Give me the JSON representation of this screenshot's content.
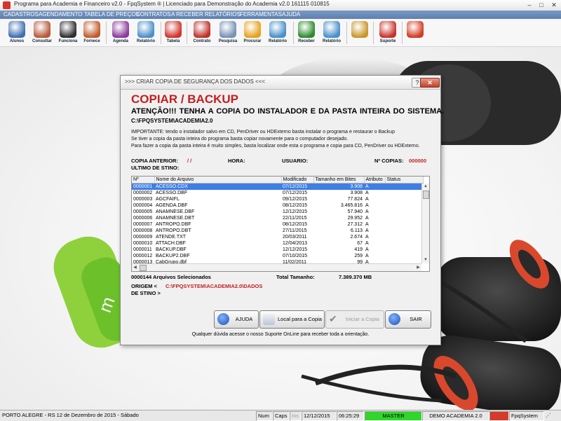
{
  "window": {
    "title": "Programa para Academia e Financeiro v2.0 - FpqSystem ® | Licenciado para  Demonstração do Academia v2.0 161115 010815",
    "minimize": "–",
    "maximize": "□",
    "close": "✕"
  },
  "menu": [
    "CADASTROS",
    "AGENDAMENTO",
    "TABELA DE PREÇOS",
    "CONTRATOS",
    "A RECEBER",
    "RELATÓRIOS",
    "FERRAMENTAS",
    "AJUDA"
  ],
  "toolbar": [
    {
      "label": "Alunos",
      "icon": "students-icon",
      "color": "#3f6fb3"
    },
    {
      "label": "Consultar",
      "icon": "id-card-icon",
      "color": "#b85a3a"
    },
    {
      "label": "Funciona",
      "icon": "employees-icon",
      "color": "#2f2f2f"
    },
    {
      "label": "Fornece",
      "icon": "supplier-icon",
      "color": "#c25c2c"
    },
    {
      "label": "Agenda",
      "icon": "calendar-icon",
      "color": "#8c3b9d"
    },
    {
      "label": "Relatório",
      "icon": "report-icon",
      "color": "#4a90c9"
    },
    {
      "label": "Tabela",
      "icon": "price-table-icon",
      "color": "#d0342c"
    },
    {
      "label": "Contrato",
      "icon": "contract-pen-icon",
      "color": "#c0312b"
    },
    {
      "label": "Pesquisa",
      "icon": "search-document-icon",
      "color": "#7891b5"
    },
    {
      "label": "Procurar",
      "icon": "folder-icon",
      "color": "#e6a21f"
    },
    {
      "label": "Relatório",
      "icon": "report-icon",
      "color": "#4a90c9"
    },
    {
      "label": "Receber",
      "icon": "dollar-icon",
      "color": "#2e8b2e"
    },
    {
      "label": "Relatório",
      "icon": "report-icon",
      "color": "#4a90c9"
    },
    {
      "label": "",
      "icon": "coins-icon",
      "color": "#c8962a"
    },
    {
      "label": "Suporte",
      "icon": "support-icon",
      "color": "#c7342b"
    },
    {
      "label": "",
      "icon": "exit-icon",
      "color": "#d23b22"
    }
  ],
  "dialog": {
    "title": ">>> CRIAR COPIA DE SEGURANÇA DOS DADOS <<<",
    "help_button": "?",
    "close_button": "✕",
    "heading": "COPIAR / BACKUP",
    "warning": "ATENÇÃO!!!  TENHA A COPIA DO  INSTALADOR  E  DA PASTA INTEIRA DO  SISTEMA.",
    "install_path": "C:\\FPQSYSTEM\\ACADEMIA2.0",
    "info_lines": [
      "IMPORTANTE: tendo o instalador salvo em CD, PenDriver ou HDExterno basta instalar o programa e restaurar o Backup",
      "Se tiver a copia da pasta inteira do programa basta copiar novamente para o computador desejado.",
      "Para fazer a copia da pasta inteira é muito simples, basta localizar onde esta o programa e copia para CD, PenDriver ou HDExterno."
    ],
    "copy_previous_label": "COPIA ANTERIOR:",
    "copy_previous_value": "/  /",
    "hour_label": "HORA:",
    "user_label": "USUARIO:",
    "copies_label": "Nº COPIAS:",
    "copies_value": "000000",
    "last_destination_label": "ULTIMO DE STINO:",
    "columns": [
      "Nº",
      "Nome do Arquivo",
      "Modificado",
      "Tamanho em Bites",
      "Atributo",
      "Status"
    ],
    "rows": [
      [
        "0000001",
        "ACESSO.CDX",
        "07/12/2015",
        "3.908",
        "A",
        ""
      ],
      [
        "0000002",
        "ACESSO.DBF",
        "07/12/2015",
        "3.908",
        "A",
        ""
      ],
      [
        "0000003",
        "AGCFAIFL",
        "09/12/2015",
        "77.824",
        "A",
        ""
      ],
      [
        "0000004",
        "AGENDA.DBF",
        "08/12/2015",
        "3.465.816",
        "A",
        ""
      ],
      [
        "0000005",
        "ANAMNESE.DBF",
        "12/12/2015",
        "57.940",
        "A",
        ""
      ],
      [
        "0000006",
        "ANAMNESE.DBT",
        "22/11/2015",
        "29.952",
        "A",
        ""
      ],
      [
        "0000007",
        "ANTROPO.DBF",
        "08/12/2015",
        "27.312",
        "A",
        ""
      ],
      [
        "0000008",
        "ANTROPO.DBT",
        "27/11/2015",
        "6.113",
        "A",
        ""
      ],
      [
        "0000009",
        "ATENDE.TXT",
        "20/03/2011",
        "2.674",
        "A",
        ""
      ],
      [
        "0000010",
        "ATTACH.DBF",
        "12/04/2013",
        "67",
        "A",
        ""
      ],
      [
        "0000011",
        "BACKUP.DBF",
        "12/12/2015",
        "419",
        "A",
        ""
      ],
      [
        "0000012",
        "BACKUP2.DBF",
        "07/10/2015",
        "259",
        "A",
        ""
      ],
      [
        "0000013",
        "CabGrupo.dbf",
        "11/02/2011",
        "99",
        "A",
        ""
      ]
    ],
    "selected_files_label": "0000144 Arquivos Selecionados",
    "total_size_label": "Total Tamanho:",
    "total_size_value": "7.389.370 MB",
    "origin_label": "ORIGEM  <",
    "origin_value": "C:\\FPQSYSTEM\\ACADEMIA2.0\\DADOS",
    "destination_label": "DE STINO >",
    "buttons": {
      "help": "AJUDA",
      "local": "Local para a Copia",
      "start": "Iniciar a Copia",
      "exit": "SAIR"
    },
    "hint": "Qualquer dúvida acesse o nosso Suporte OnLine para receber toda a orientação."
  },
  "status": {
    "location": "PORTO ALEGRE - RS 12 de Dezembro de 2015 - Sábado",
    "num": "Num",
    "caps": "Caps",
    "ins": "Ins",
    "date": "12/12/2015",
    "time": "06:25:29",
    "user": "MASTER",
    "company": "DEMO ACADEMIA 2.0",
    "brand": "FpqSystem"
  },
  "colors": {
    "accent_red": "#c41e1e",
    "selection": "#3f7ee3",
    "status_green": "#31d62b",
    "menu_blue": "#5d7fb0"
  }
}
